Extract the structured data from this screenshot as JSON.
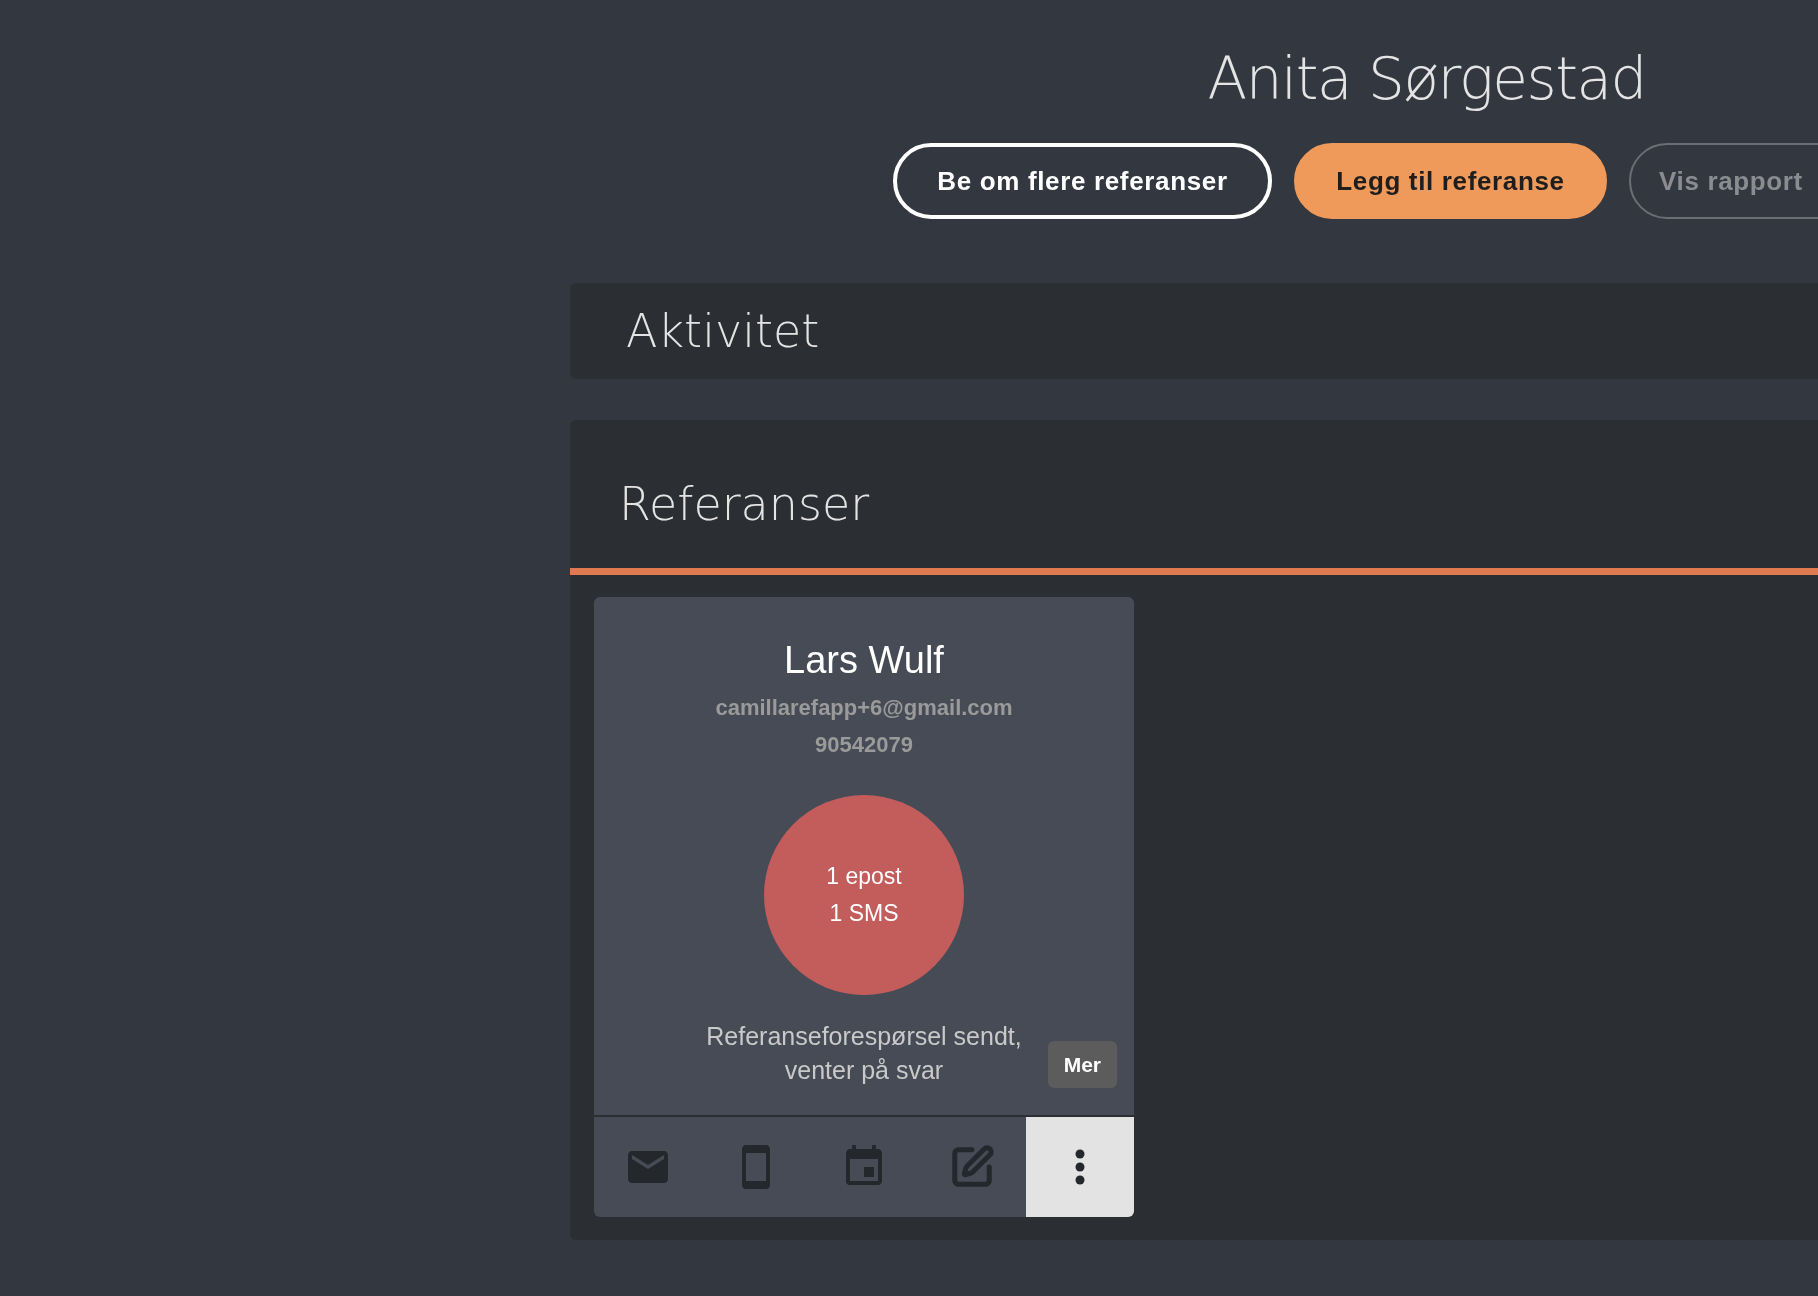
{
  "title": "Anita Sørgestad",
  "actions": [
    {
      "label": "Be om flere referanser",
      "kind": "outline"
    },
    {
      "label": "Legg til referanse",
      "kind": "primary"
    },
    {
      "label": "Vis rapport",
      "kind": "ghost"
    }
  ],
  "activity": {
    "title": "Aktivitet"
  },
  "references": {
    "title": "Referanser",
    "cards": [
      {
        "name": "Lars Wulf",
        "email": "camillarefapp+6@gmail.com",
        "phone": "90542079",
        "status_lines": [
          "1 epost",
          "1 SMS"
        ],
        "color": "#c25d5b",
        "status_text": "Referanseforespørsel sendt, venter på svar",
        "more_label": "Mer",
        "toolbar": [
          {
            "kind": "mail",
            "selected": false
          },
          {
            "kind": "phone",
            "selected": false
          },
          {
            "kind": "calendar",
            "selected": false
          },
          {
            "kind": "edit",
            "selected": false
          },
          {
            "kind": "more",
            "selected": true
          }
        ]
      }
    ]
  }
}
